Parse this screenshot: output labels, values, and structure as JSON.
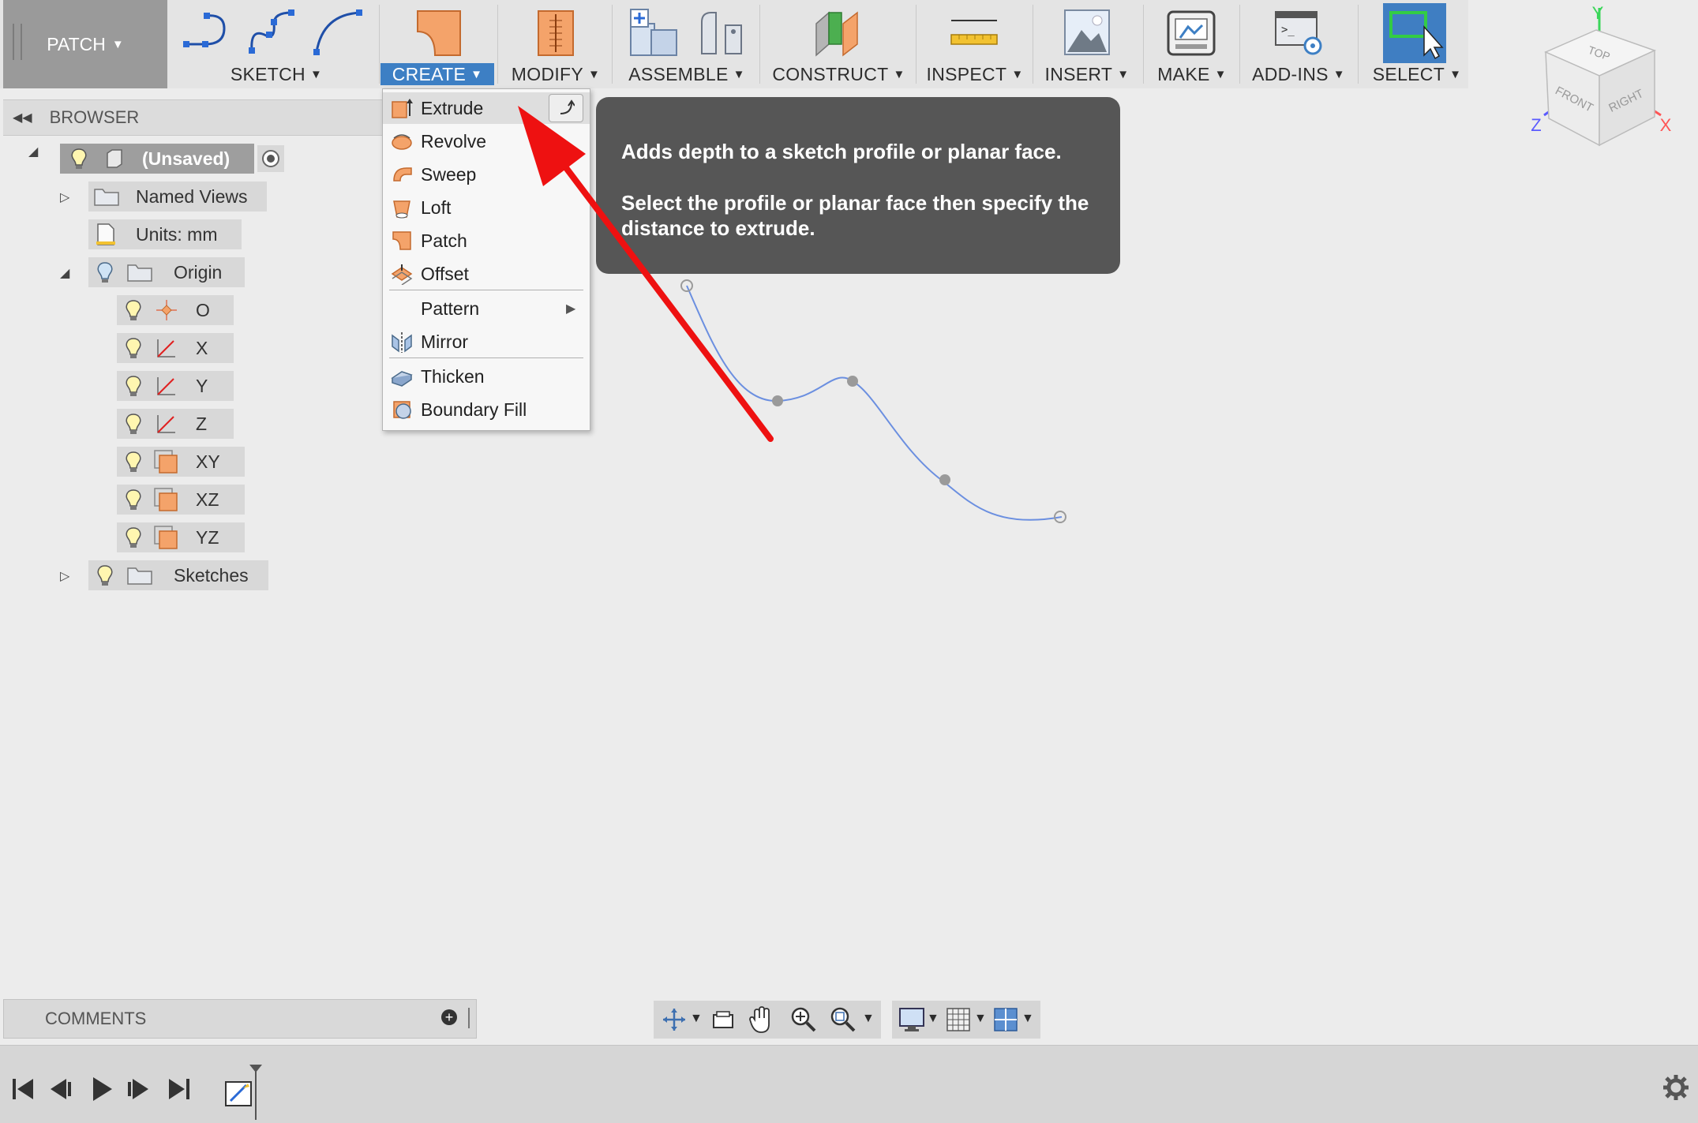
{
  "toolbar": {
    "workspace": "PATCH",
    "groups": {
      "sketch": "SKETCH",
      "create": "CREATE",
      "modify": "MODIFY",
      "assemble": "ASSEMBLE",
      "construct": "CONSTRUCT",
      "inspect": "INSPECT",
      "insert": "INSERT",
      "make": "MAKE",
      "addins": "ADD-INS",
      "select": "SELECT"
    }
  },
  "browser": {
    "title": "BROWSER",
    "root": "(Unsaved)",
    "named_views": "Named Views",
    "units": "Units: mm",
    "origin": {
      "label": "Origin",
      "items": [
        "O",
        "X",
        "Y",
        "Z",
        "XY",
        "XZ",
        "YZ"
      ]
    },
    "sketches": "Sketches"
  },
  "create_menu": {
    "items": [
      "Extrude",
      "Revolve",
      "Sweep",
      "Loft",
      "Patch",
      "Offset",
      "Pattern",
      "Mirror",
      "Thicken",
      "Boundary Fill"
    ]
  },
  "tooltip": {
    "line1": "Adds depth to a sketch profile or planar face.",
    "line2": "Select the profile or planar face then specify the distance to extrude."
  },
  "viewcube": {
    "top": "TOP",
    "front": "FRONT",
    "right": "RIGHT",
    "axis_x": "X",
    "axis_y": "Y",
    "axis_z": "Z"
  },
  "comments": {
    "title": "COMMENTS"
  },
  "colors": {
    "accent": "#3d7fc4",
    "annotation_arrow": "#ee1111",
    "tooltip_bg": "#565656",
    "face_orange": "#f0a070"
  }
}
